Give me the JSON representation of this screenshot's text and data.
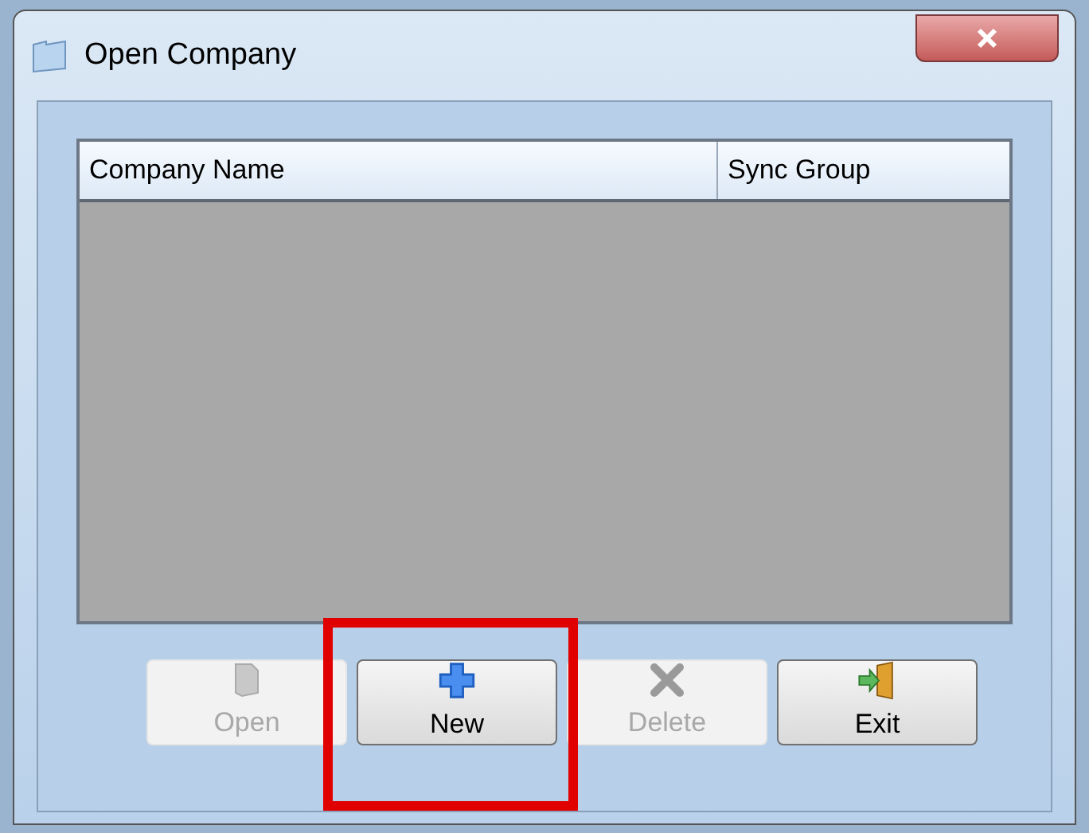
{
  "window": {
    "title": "Open Company"
  },
  "table": {
    "columns": [
      "Company Name",
      "Sync Group"
    ]
  },
  "buttons": [
    {
      "label": "Open",
      "kind": "open",
      "disabled": true,
      "highlighted": false
    },
    {
      "label": "New",
      "kind": "new",
      "disabled": false,
      "highlighted": true
    },
    {
      "label": "Delete",
      "kind": "delete",
      "disabled": true,
      "highlighted": false
    },
    {
      "label": "Exit",
      "kind": "exit",
      "disabled": false,
      "highlighted": false
    }
  ]
}
